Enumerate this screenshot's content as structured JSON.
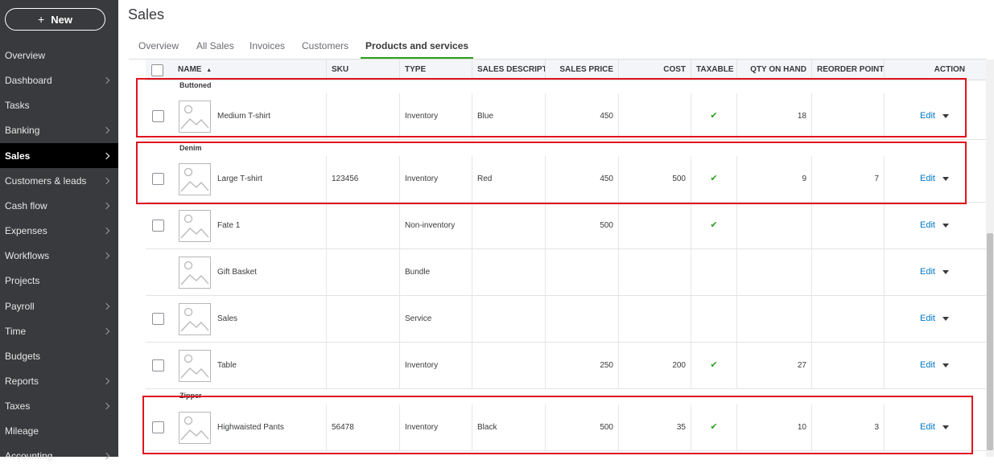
{
  "sidebar": {
    "new_button": "New",
    "items": [
      {
        "label": "Overview",
        "chevron": false
      },
      {
        "label": "Dashboard",
        "chevron": true
      },
      {
        "label": "Tasks",
        "chevron": false
      },
      {
        "label": "Banking",
        "chevron": true
      },
      {
        "label": "Sales",
        "chevron": true,
        "active": true
      },
      {
        "label": "Customers & leads",
        "chevron": true
      },
      {
        "label": "Cash flow",
        "chevron": true
      },
      {
        "label": "Expenses",
        "chevron": true
      },
      {
        "label": "Workflows",
        "chevron": true
      },
      {
        "label": "Projects",
        "chevron": false
      },
      {
        "label": "Payroll",
        "chevron": true
      },
      {
        "label": "Time",
        "chevron": true
      },
      {
        "label": "Budgets",
        "chevron": false
      },
      {
        "label": "Reports",
        "chevron": true
      },
      {
        "label": "Taxes",
        "chevron": true
      },
      {
        "label": "Mileage",
        "chevron": false
      },
      {
        "label": "Accounting",
        "chevron": true
      }
    ]
  },
  "page": {
    "title": "Sales"
  },
  "tabs": [
    "Overview",
    "All Sales",
    "Invoices",
    "Customers",
    "Products and services"
  ],
  "table": {
    "headers": {
      "name": "NAME",
      "sku": "SKU",
      "type": "TYPE",
      "description": "SALES DESCRIPTION",
      "price": "SALES PRICE",
      "cost": "COST",
      "taxable": "TAXABLE",
      "qty": "QTY ON HAND",
      "reorder": "REORDER POINT",
      "action": "ACTION"
    },
    "groups": [
      "Buttoned",
      "Denim",
      "Zipper"
    ],
    "rows": [
      {
        "name": "Medium T-shirt",
        "sku": "",
        "type": "Inventory",
        "description": "Blue",
        "price": "450",
        "cost": "",
        "taxable": "✔",
        "qty": "18",
        "reorder": "",
        "action": "Edit"
      },
      {
        "name": "Large T-shirt",
        "sku": "123456",
        "type": "Inventory",
        "description": "Red",
        "price": "450",
        "cost": "500",
        "taxable": "✔",
        "qty": "9",
        "reorder": "7",
        "action": "Edit"
      },
      {
        "name": "Fate 1",
        "sku": "",
        "type": "Non-inventory",
        "description": "",
        "price": "500",
        "cost": "",
        "taxable": "✔",
        "qty": "",
        "reorder": "",
        "action": "Edit"
      },
      {
        "name": "Gift Basket",
        "sku": "",
        "type": "Bundle",
        "description": "",
        "price": "",
        "cost": "",
        "taxable": "",
        "qty": "",
        "reorder": "",
        "action": "Edit"
      },
      {
        "name": "Sales",
        "sku": "",
        "type": "Service",
        "description": "",
        "price": "",
        "cost": "",
        "taxable": "",
        "qty": "",
        "reorder": "",
        "action": "Edit"
      },
      {
        "name": "Table",
        "sku": "",
        "type": "Inventory",
        "description": "",
        "price": "250",
        "cost": "200",
        "taxable": "✔",
        "qty": "27",
        "reorder": "",
        "action": "Edit"
      },
      {
        "name": "Highwaisted Pants",
        "sku": "56478",
        "type": "Inventory",
        "description": "Black",
        "price": "500",
        "cost": "35",
        "taxable": "✔",
        "qty": "10",
        "reorder": "3",
        "action": "Edit"
      }
    ]
  },
  "colors": {
    "accent_green": "#2ca01c",
    "link_blue": "#0077c5",
    "sidebar_bg": "#393a3d",
    "highlight_red": "#e0141e"
  },
  "icons": [
    "plus-icon",
    "chevron-right-icon",
    "sort-up-icon",
    "image-placeholder-icon",
    "checkmark-icon",
    "caret-down-icon"
  ]
}
